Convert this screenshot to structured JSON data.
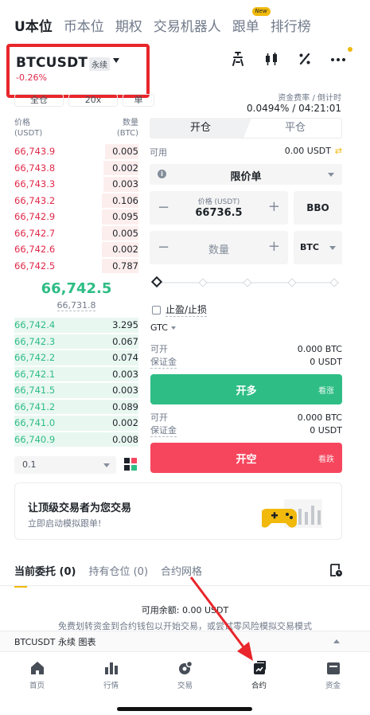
{
  "top_tabs": [
    {
      "label": "U本位",
      "active": true
    },
    {
      "label": "币本位",
      "active": false
    },
    {
      "label": "期权",
      "active": false
    },
    {
      "label": "交易机器人",
      "active": false
    },
    {
      "label": "跟单",
      "active": false,
      "badge": "New"
    },
    {
      "label": "排行榜",
      "active": false
    }
  ],
  "pair": {
    "symbol": "BTCUSDT",
    "type": "永续",
    "change": "-0.26%"
  },
  "funding": {
    "label": "资金费率 / 倒计时",
    "value": "0.0494% / 04:21:01"
  },
  "mode_pills": [
    "全仓",
    "20x",
    "单"
  ],
  "orderbook": {
    "price_header": "价格\n(USDT)",
    "price_header_1": "价格",
    "price_header_2": "(USDT)",
    "qty_header_1": "数量",
    "qty_header_2": "(BTC)",
    "asks": [
      {
        "price": "66,743.9",
        "qty": "0.005"
      },
      {
        "price": "66,743.8",
        "qty": "0.002"
      },
      {
        "price": "66,743.3",
        "qty": "0.003"
      },
      {
        "price": "66,743.2",
        "qty": "0.106"
      },
      {
        "price": "66,742.9",
        "qty": "0.095"
      },
      {
        "price": "66,742.7",
        "qty": "0.005"
      },
      {
        "price": "66,742.6",
        "qty": "0.002"
      },
      {
        "price": "66,742.5",
        "qty": "0.787"
      }
    ],
    "mid_price": "66,742.5",
    "mark_price": "66,731.8",
    "bids": [
      {
        "price": "66,742.4",
        "qty": "3.295"
      },
      {
        "price": "66,742.3",
        "qty": "0.067"
      },
      {
        "price": "66,742.2",
        "qty": "0.074"
      },
      {
        "price": "66,742.1",
        "qty": "0.003"
      },
      {
        "price": "66,741.5",
        "qty": "0.003"
      },
      {
        "price": "66,741.2",
        "qty": "0.089"
      },
      {
        "price": "66,741.0",
        "qty": "0.002"
      },
      {
        "price": "66,740.9",
        "qty": "0.008"
      }
    ],
    "depth": "0.1"
  },
  "form": {
    "open_tab": "开仓",
    "close_tab": "平仓",
    "available_label": "可用",
    "available_value": "0.00 USDT",
    "order_type": "限价单",
    "price_label": "价格 (USDT)",
    "price_value": "66736.5",
    "bbo": "BBO",
    "qty_placeholder": "数量",
    "qty_unit": "BTC",
    "tpsl_label": "止盈/止损",
    "tif": "GTC",
    "long_info": [
      {
        "k": "可开",
        "v": "0.000 BTC"
      },
      {
        "k": "保证金",
        "v": "0 USDT"
      }
    ],
    "long_button": "开多",
    "long_sub": "看涨",
    "short_info": [
      {
        "k": "可开",
        "v": "0.000 BTC"
      },
      {
        "k": "保证金",
        "v": "0 USDT"
      }
    ],
    "short_button": "开空",
    "short_sub": "看跌"
  },
  "copy_card": {
    "title": "让顶级交易者为您交易",
    "subtitle": "立即启动模拟跟单!"
  },
  "position_tabs": [
    {
      "label": "当前委托 (0)",
      "active": true
    },
    {
      "label": "持有仓位 (0)",
      "active": false
    },
    {
      "label": "合约网格",
      "active": false
    }
  ],
  "available_balance": "可用余额:  0.00 USDT",
  "transfer_hint": "免费划转资金到合约钱包以开始交易，或尝试零风险模拟交易模式",
  "chart_bar": "BTCUSDT 永续 图表",
  "nav": [
    {
      "label": "首页",
      "icon": "home-icon",
      "active": false
    },
    {
      "label": "行情",
      "icon": "markets-icon",
      "active": false
    },
    {
      "label": "交易",
      "icon": "trade-icon",
      "active": false
    },
    {
      "label": "合约",
      "icon": "futures-icon",
      "active": true
    },
    {
      "label": "资金",
      "icon": "wallet-icon",
      "active": false
    }
  ],
  "colors": {
    "accent": "#f0b90b",
    "buy": "#2ebd85",
    "sell": "#f6465d",
    "annotation": "#e8262b"
  }
}
